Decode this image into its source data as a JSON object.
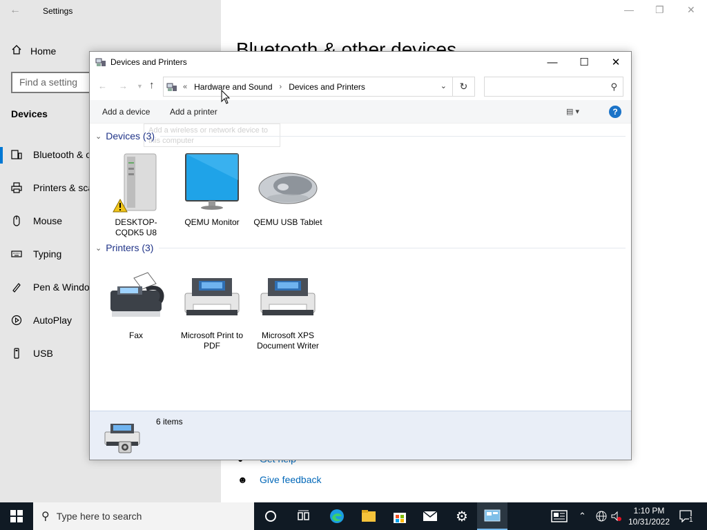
{
  "settings": {
    "title": "Settings",
    "home": "Home",
    "find_placeholder": "Find a setting",
    "section": "Devices",
    "nav_items": [
      {
        "label": "Bluetooth & other devices",
        "icon": "bluetooth-devices-icon"
      },
      {
        "label": "Printers & scanners",
        "icon": "printer-icon"
      },
      {
        "label": "Mouse",
        "icon": "mouse-icon"
      },
      {
        "label": "Typing",
        "icon": "keyboard-icon"
      },
      {
        "label": "Pen & Windows Ink",
        "icon": "pen-icon"
      },
      {
        "label": "AutoPlay",
        "icon": "autoplay-icon"
      },
      {
        "label": "USB",
        "icon": "usb-icon"
      }
    ],
    "page_heading": "Bluetooth & other devices",
    "links": {
      "get_help": "Get help",
      "give_feedback": "Give feedback"
    }
  },
  "window": {
    "title": "Devices and Printers",
    "breadcrumb": [
      "Hardware and Sound",
      "Devices and Printers"
    ],
    "search_placeholder": "",
    "commands": {
      "add_device": "Add a device",
      "add_printer": "Add a printer"
    },
    "tooltip": "Add a wireless or network device to this computer",
    "groups": {
      "devices": {
        "label": "Devices (3)",
        "items": [
          "DESKTOP-CQDK5 U8",
          "QEMU Monitor",
          "QEMU USB Tablet"
        ]
      },
      "printers": {
        "label": "Printers (3)",
        "items": [
          "Fax",
          "Microsoft Print to PDF",
          "Microsoft XPS Document Writer"
        ]
      }
    },
    "details": {
      "count": "6 items"
    }
  },
  "taskbar": {
    "search_placeholder": "Type here to search",
    "time": "1:10 PM",
    "date": "10/31/2022",
    "notification_count": "1"
  },
  "colors": {
    "accent": "#0078d4",
    "group_header": "#1e3287",
    "taskbar": "#101a24",
    "details_pane": "#e9eef7"
  }
}
